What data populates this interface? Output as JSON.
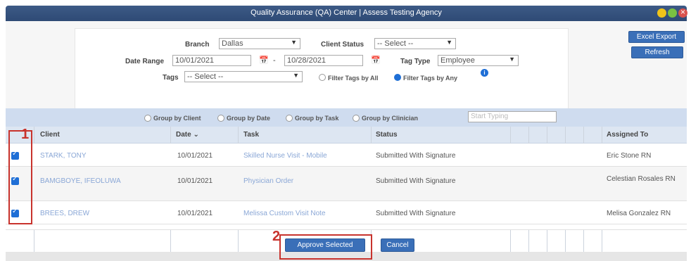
{
  "window": {
    "title": "Quality Assurance (QA) Center | Assess Testing Agency"
  },
  "filters": {
    "branch_label": "Branch",
    "branch_value": "Dallas",
    "client_status_label": "Client Status",
    "client_status_value": "-- Select --",
    "date_range_label": "Date Range",
    "date_from": "10/01/2021",
    "date_sep": "-",
    "date_to": "10/28/2021",
    "tag_type_label": "Tag Type",
    "tag_type_value": "Employee",
    "tags_label": "Tags",
    "tags_value": "-- Select --",
    "filter_all_label": "Filter Tags by All",
    "filter_any_label": "Filter Tags by Any"
  },
  "actions": {
    "excel_label": "Excel Export",
    "refresh_label": "Refresh"
  },
  "grouping": {
    "options": [
      "Group by Client",
      "Group by Date",
      "Group by Task",
      "Group by Clinician"
    ],
    "search_placeholder": "Start Typing"
  },
  "table": {
    "headers": {
      "client": "Client",
      "date": "Date",
      "task": "Task",
      "status": "Status",
      "assigned": "Assigned To"
    },
    "rows": [
      {
        "client": "STARK, TONY",
        "date": "10/01/2021",
        "task": "Skilled Nurse Visit - Mobile",
        "status": "Submitted With Signature",
        "assigned": "Eric Stone RN"
      },
      {
        "client": "BAMGBOYE, IFEOLUWA",
        "date": "10/01/2021",
        "task": "Physician Order",
        "status": "Submitted With Signature",
        "assigned": "Celestian Rosales RN"
      },
      {
        "client": "BREES, DREW",
        "date": "10/01/2021",
        "task": "Melissa Custom Visit Note",
        "status": "Submitted With Signature",
        "assigned": "Melisa Gonzalez RN"
      }
    ]
  },
  "footer": {
    "approve_label": "Approve Selected",
    "cancel_label": "Cancel"
  },
  "annotations": {
    "one": "1",
    "two": "2"
  }
}
